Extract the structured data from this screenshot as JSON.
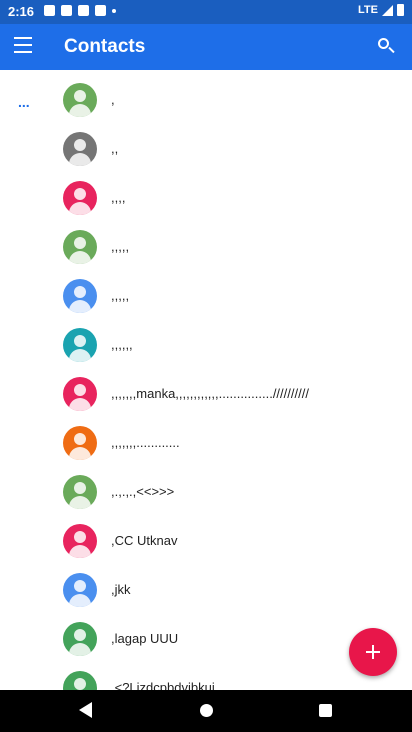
{
  "status_bar": {
    "time": "2:16",
    "network": "LTE"
  },
  "app_bar": {
    "title": "Contacts",
    "menu_icon": "hamburger-menu-icon",
    "search_icon": "search-icon"
  },
  "section_marker": "...",
  "contacts": [
    {
      "name": ",",
      "avatar_color": "#6aaa5a"
    },
    {
      "name": ",,",
      "avatar_color": "#757575"
    },
    {
      "name": ",,,,",
      "avatar_color": "#e8245e"
    },
    {
      "name": ",,,,,",
      "avatar_color": "#6aaa5a"
    },
    {
      "name": ",,,,,",
      "avatar_color": "#4a8fef"
    },
    {
      "name": ",,,,,,",
      "avatar_color": "#1aa3b0"
    },
    {
      "name": ",,,,,,,manka,,,,,,,,,,,,...............//////////",
      "avatar_color": "#e8245e"
    },
    {
      "name": ",,,,,,,............",
      "avatar_color": "#ef6c14"
    },
    {
      "name": ",.,.,.,<<>>>",
      "avatar_color": "#6aaa5a"
    },
    {
      "name": ",CC Utknav",
      "avatar_color": "#e8245e"
    },
    {
      "name": ",jkk",
      "avatar_color": "#4a8fef"
    },
    {
      "name": ",lagap UUU",
      "avatar_color": "#43a35a"
    },
    {
      "name": ",<?Lizdcpbdvibkui",
      "avatar_color": "#43a35a"
    }
  ],
  "fab": {
    "icon": "plus-icon",
    "color": "#e8164a"
  },
  "nav_bar": {
    "back_icon": "back-triangle-icon",
    "home_icon": "home-circle-icon",
    "recents_icon": "recents-square-icon"
  }
}
